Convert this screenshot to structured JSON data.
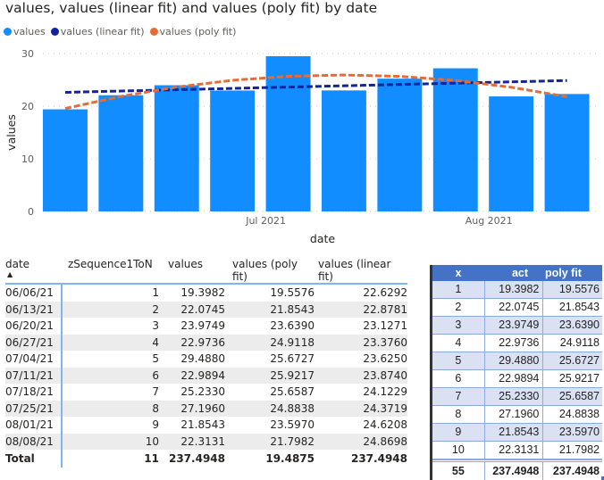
{
  "title": "values, values (linear fit) and values (poly fit) by date",
  "legend": [
    {
      "label": "values",
      "color": "#118dff"
    },
    {
      "label": "values (linear fit)",
      "color": "#12239e"
    },
    {
      "label": "values (poly fit)",
      "color": "#e66c37"
    }
  ],
  "chart_data": {
    "type": "bar",
    "title": "values, values (linear fit) and values (poly fit) by date",
    "xlabel": "date",
    "ylabel": "values",
    "ylim": [
      0,
      30
    ],
    "yticks": [
      "0",
      "10",
      "20",
      "30"
    ],
    "xticks": [
      {
        "label": "Jul 2021",
        "index": 4
      },
      {
        "label": "Aug 2021",
        "index": 8
      }
    ],
    "grid": true,
    "legend_position": "top-left",
    "categories": [
      "06/06/21",
      "06/13/21",
      "06/20/21",
      "06/27/21",
      "07/04/21",
      "07/11/21",
      "07/18/21",
      "07/25/21",
      "08/01/21",
      "08/08/21"
    ],
    "series": [
      {
        "name": "values",
        "type": "bar",
        "color": "#118dff",
        "values": [
          19.3982,
          22.0745,
          23.9749,
          22.9736,
          29.488,
          22.9894,
          25.233,
          27.196,
          21.8543,
          22.3131
        ]
      },
      {
        "name": "values (linear fit)",
        "type": "line-dashed",
        "color": "#12239e",
        "values": [
          22.6292,
          22.8781,
          23.1271,
          23.376,
          23.625,
          23.874,
          24.1229,
          24.3719,
          24.6208,
          24.8698
        ]
      },
      {
        "name": "values (poly fit)",
        "type": "line-dashed",
        "color": "#e66c37",
        "values": [
          19.5576,
          21.8543,
          23.639,
          24.9118,
          25.6727,
          25.9217,
          25.6587,
          24.8838,
          23.597,
          21.7982
        ]
      }
    ]
  },
  "table": {
    "headers": [
      "date",
      "zSequence1ToN",
      "values",
      "values (poly fit)",
      "values (linear fit)"
    ],
    "sort_indicator": "▲",
    "rows": [
      [
        "06/06/21",
        "1",
        "19.3982",
        "19.5576",
        "22.6292"
      ],
      [
        "06/13/21",
        "2",
        "22.0745",
        "21.8543",
        "22.8781"
      ],
      [
        "06/20/21",
        "3",
        "23.9749",
        "23.6390",
        "23.1271"
      ],
      [
        "06/27/21",
        "4",
        "22.9736",
        "24.9118",
        "23.3760"
      ],
      [
        "07/04/21",
        "5",
        "29.4880",
        "25.6727",
        "23.6250"
      ],
      [
        "07/11/21",
        "6",
        "22.9894",
        "25.9217",
        "23.8740"
      ],
      [
        "07/18/21",
        "7",
        "25.2330",
        "25.6587",
        "24.1229"
      ],
      [
        "07/25/21",
        "8",
        "27.1960",
        "24.8838",
        "24.3719"
      ],
      [
        "08/01/21",
        "9",
        "21.8543",
        "23.5970",
        "24.6208"
      ],
      [
        "08/08/21",
        "10",
        "22.3131",
        "21.7982",
        "24.8698"
      ]
    ],
    "total": [
      "Total",
      "11",
      "237.4948",
      "19.4875",
      "237.4948"
    ]
  },
  "excel": {
    "headers": [
      "x",
      "act",
      "poly fit"
    ],
    "rows": [
      [
        "1",
        "19.3982",
        "19.5576"
      ],
      [
        "2",
        "22.0745",
        "21.8543"
      ],
      [
        "3",
        "23.9749",
        "23.6390"
      ],
      [
        "4",
        "22.9736",
        "24.9118"
      ],
      [
        "5",
        "29.4880",
        "25.6727"
      ],
      [
        "6",
        "22.9894",
        "25.9217"
      ],
      [
        "7",
        "25.2330",
        "25.6587"
      ],
      [
        "8",
        "27.1960",
        "24.8838"
      ],
      [
        "9",
        "21.8543",
        "23.5970"
      ],
      [
        "10",
        "22.3131",
        "21.7982"
      ]
    ],
    "total": [
      "55",
      "237.4948",
      "237.4948"
    ]
  }
}
